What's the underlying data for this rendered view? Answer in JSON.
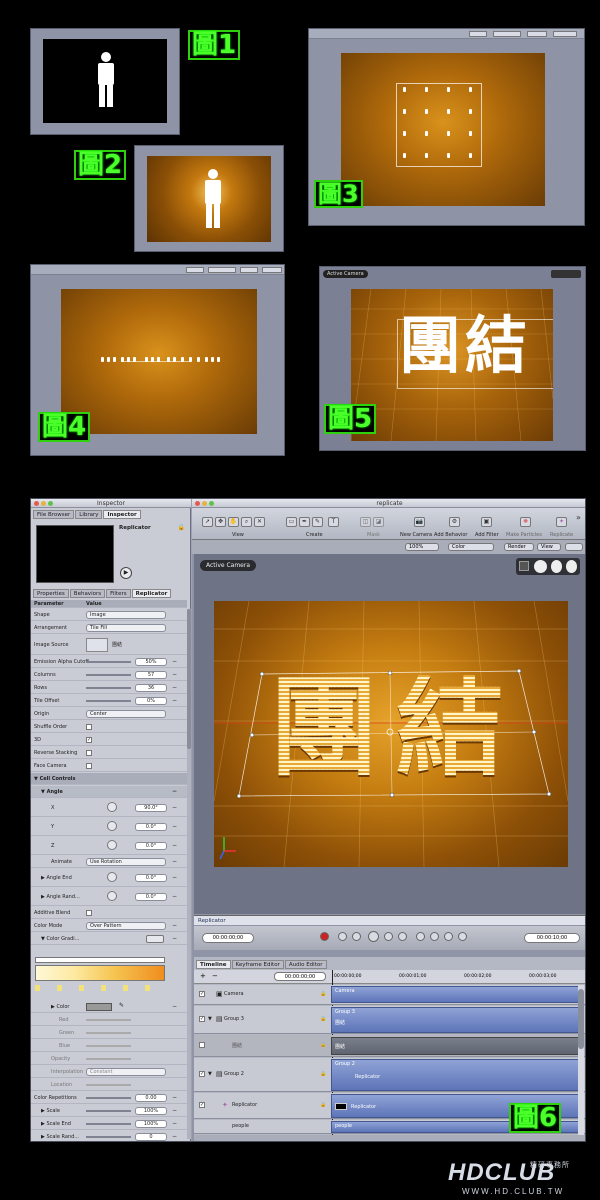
{
  "figure_labels": {
    "f1": "圖1",
    "f2": "圖2",
    "f3": "圖3",
    "f4": "圖4",
    "f5": "圖5",
    "f6": "圖6"
  },
  "small_toolbar": {
    "zoom": "100%",
    "color": "Color",
    "view": "View"
  },
  "fig5": {
    "camera": "Active Camera",
    "text": "團結"
  },
  "window": {
    "inspector_title": "Inspector",
    "main_title": "replicate"
  },
  "inspector": {
    "top_tabs": [
      "File Browser",
      "Library",
      "Inspector"
    ],
    "preview_name": "Replicator",
    "sub_tabs": [
      "Properties",
      "Behaviors",
      "Filters",
      "Replicator"
    ],
    "col_param": "Parameter",
    "col_value": "Value",
    "rows": {
      "shape": {
        "label": "Shape",
        "value": "Image"
      },
      "arrangement": {
        "label": "Arrangement",
        "value": "Tile Fill"
      },
      "image_source": {
        "label": "Image Source",
        "value": "團結"
      },
      "emission": {
        "label": "Emission Alpha Cutoff",
        "value": "50%"
      },
      "columns": {
        "label": "Columns",
        "value": "57"
      },
      "rows": {
        "label": "Rows",
        "value": "36"
      },
      "tile_offset": {
        "label": "Tile Offset",
        "value": "0%"
      },
      "origin": {
        "label": "Origin",
        "value": "Center"
      },
      "shuffle": {
        "label": "Shuffle Order"
      },
      "three_d": {
        "label": "3D"
      },
      "reverse": {
        "label": "Reverse Stacking"
      },
      "face_camera": {
        "label": "Face Camera"
      },
      "cell_controls": {
        "label": "Cell Controls"
      },
      "angle": {
        "label": "Angle"
      },
      "x": {
        "label": "X",
        "value": "90.0°"
      },
      "y": {
        "label": "Y",
        "value": "0.0°"
      },
      "z": {
        "label": "Z",
        "value": "0.0°"
      },
      "animate": {
        "label": "Animate",
        "value": "Use Rotation"
      },
      "angle_end": {
        "label": "Angle End",
        "value": "0.0°"
      },
      "angle_rand": {
        "label": "Angle Rand...",
        "value": "0.0°"
      },
      "additive": {
        "label": "Additive Blend"
      },
      "color_mode": {
        "label": "Color Mode",
        "value": "Over Pattern"
      },
      "color_grad": {
        "label": "Color Gradi..."
      },
      "color": {
        "label": "Color"
      },
      "red": {
        "label": "Red"
      },
      "green": {
        "label": "Green"
      },
      "blue": {
        "label": "Blue"
      },
      "opacity": {
        "label": "Opacity"
      },
      "interpolation": {
        "label": "Interpolation",
        "value": "Constant"
      },
      "location": {
        "label": "Location"
      },
      "color_rep": {
        "label": "Color Repetitions",
        "value": "0.00"
      },
      "scale": {
        "label": "Scale",
        "value": "100%"
      },
      "scale_end": {
        "label": "Scale End",
        "value": "100%"
      },
      "scale_rand": {
        "label": "Scale Rand...",
        "value": "0"
      }
    }
  },
  "toolbar": {
    "view": "View",
    "create": "Create",
    "mask": "Mask",
    "new_camera": "New Camera",
    "add_behavior": "Add Behavior",
    "add_filter": "Add Filter",
    "make_particles": "Make Particles",
    "replicate": "Replicate",
    "zoom": "100%",
    "color": "Color",
    "render": "Render",
    "view_menu": "View"
  },
  "canvas": {
    "camera": "Active Camera",
    "text": "團結",
    "layer": "Replicator"
  },
  "transport": {
    "start_tc": "00:00:00;00",
    "end_tc": "00:00:10;00"
  },
  "timeline": {
    "tabs": [
      "Timeline",
      "Keyframe Editor",
      "Audio Editor"
    ],
    "tc": "00:00:00;00",
    "ruler": [
      "00:00:00;00",
      "00:00:01;00",
      "00:00:02;00",
      "00:00:03;00"
    ],
    "tracks": [
      {
        "name": "Camera",
        "bar": "Camera"
      },
      {
        "name": "Group 3",
        "bar": "Group 3",
        "sub": "團結"
      },
      {
        "name": "團結",
        "bar": "團結"
      },
      {
        "name": "Group 2",
        "bar": "Group 2",
        "sub": "Replicator"
      },
      {
        "name": "Replicator",
        "bar": "Replicator"
      },
      {
        "name": "people",
        "bar": "people"
      }
    ]
  },
  "watermark": {
    "brand": "HDCLUB",
    "sub": "精研事務所",
    "url": "WWW.HD.CLUB.TW"
  }
}
